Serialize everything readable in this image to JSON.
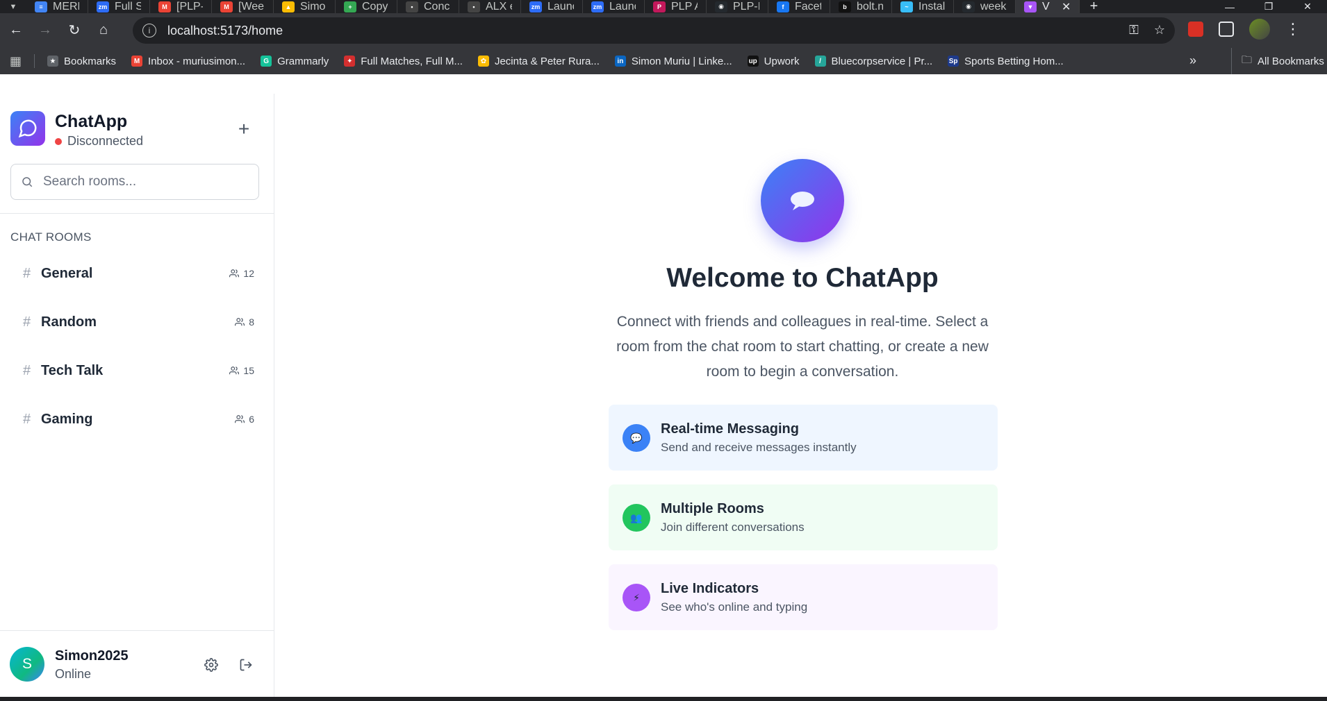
{
  "browser": {
    "tabs": [
      {
        "title": "MERN",
        "icon": "docs-icon",
        "color": "#4285f4",
        "glyph": "≡"
      },
      {
        "title": "Full S",
        "icon": "zoom-icon",
        "color": "#2d6cf6",
        "glyph": "zm"
      },
      {
        "title": "[PLP-",
        "icon": "gmail-icon",
        "color": "#ea4335",
        "glyph": "M"
      },
      {
        "title": "[Wee",
        "icon": "gmail-icon",
        "color": "#ea4335",
        "glyph": "M"
      },
      {
        "title": "Simo",
        "icon": "drive-icon",
        "color": "#fbbc04",
        "glyph": "▲"
      },
      {
        "title": "Copy",
        "icon": "sheets-icon",
        "color": "#34a853",
        "glyph": "+"
      },
      {
        "title": "Conc",
        "icon": "site-icon",
        "color": "#444444",
        "glyph": "•"
      },
      {
        "title": "ALX e",
        "icon": "site-icon",
        "color": "#444444",
        "glyph": "•"
      },
      {
        "title": "Launc",
        "icon": "zoom-icon",
        "color": "#2d6cf6",
        "glyph": "zm"
      },
      {
        "title": "Launc",
        "icon": "zoom-icon",
        "color": "#2d6cf6",
        "glyph": "zm"
      },
      {
        "title": "PLP A",
        "icon": "plp-icon",
        "color": "#c2185b",
        "glyph": "P"
      },
      {
        "title": "PLP-I",
        "icon": "github-icon",
        "color": "#24292e",
        "glyph": "◉"
      },
      {
        "title": "Facet",
        "icon": "facebook-icon",
        "color": "#1877f2",
        "glyph": "f"
      },
      {
        "title": "bolt.n",
        "icon": "bolt-icon",
        "color": "#111111",
        "glyph": "b"
      },
      {
        "title": "Instal",
        "icon": "tailwind-icon",
        "color": "#38bdf8",
        "glyph": "~"
      },
      {
        "title": "week",
        "icon": "github-icon",
        "color": "#24292e",
        "glyph": "◉"
      },
      {
        "title": "V",
        "icon": "vite-icon",
        "color": "#a855f7",
        "glyph": "▼",
        "active": true
      }
    ],
    "url": "localhost:5173/home",
    "bookmarks": [
      {
        "label": "Bookmarks",
        "icon": "star-icon",
        "color": "#5f6368",
        "glyph": "★"
      },
      {
        "label": "Inbox - muriusimon...",
        "icon": "gmail-icon",
        "color": "#ea4335",
        "glyph": "M"
      },
      {
        "label": "Grammarly",
        "icon": "grammarly-icon",
        "color": "#15c39a",
        "glyph": "G"
      },
      {
        "label": "Full Matches, Full M...",
        "icon": "sport-icon",
        "color": "#d32f2f",
        "glyph": "✦"
      },
      {
        "label": "Jecinta & Peter Rura...",
        "icon": "photos-icon",
        "color": "#fbbc04",
        "glyph": "✿"
      },
      {
        "label": "Simon Muriu | Linke...",
        "icon": "linkedin-icon",
        "color": "#0a66c2",
        "glyph": "in"
      },
      {
        "label": "Upwork",
        "icon": "upwork-icon",
        "color": "#111111",
        "glyph": "up"
      },
      {
        "label": "Bluecorpservice | Pr...",
        "icon": "feather-icon",
        "color": "#26a69a",
        "glyph": "/"
      },
      {
        "label": "Sports Betting Hom...",
        "icon": "sp-icon",
        "color": "#1e3a8a",
        "glyph": "Sp"
      }
    ],
    "all_bookmarks": "All Bookmarks"
  },
  "sidebar": {
    "app_title": "ChatApp",
    "connection_status": "Disconnected",
    "search_placeholder": "Search rooms...",
    "section_title": "CHAT ROOMS",
    "rooms": [
      {
        "name": "General",
        "count": "12"
      },
      {
        "name": "Random",
        "count": "8"
      },
      {
        "name": "Tech Talk",
        "count": "15"
      },
      {
        "name": "Gaming",
        "count": "6"
      }
    ],
    "user": {
      "initial": "S",
      "name": "Simon2025",
      "status": "Online"
    }
  },
  "main": {
    "title": "Welcome to ChatApp",
    "description": "Connect with friends and colleagues in real-time. Select a room from the chat room to start chatting, or create a new room to begin a conversation.",
    "features": [
      {
        "title": "Real-time Messaging",
        "subtitle": "Send and receive messages instantly",
        "icon": "speech-bubble-icon",
        "theme": "blue",
        "glyph": "💬"
      },
      {
        "title": "Multiple Rooms",
        "subtitle": "Join different conversations",
        "icon": "people-icon",
        "theme": "green",
        "glyph": "👥"
      },
      {
        "title": "Live Indicators",
        "subtitle": "See who's online and typing",
        "icon": "lightning-icon",
        "theme": "purple",
        "glyph": "⚡"
      }
    ]
  },
  "colors": {
    "accent_gradient_start": "#3b82f6",
    "accent_gradient_end": "#9333ea",
    "disconnected": "#ef4444"
  }
}
